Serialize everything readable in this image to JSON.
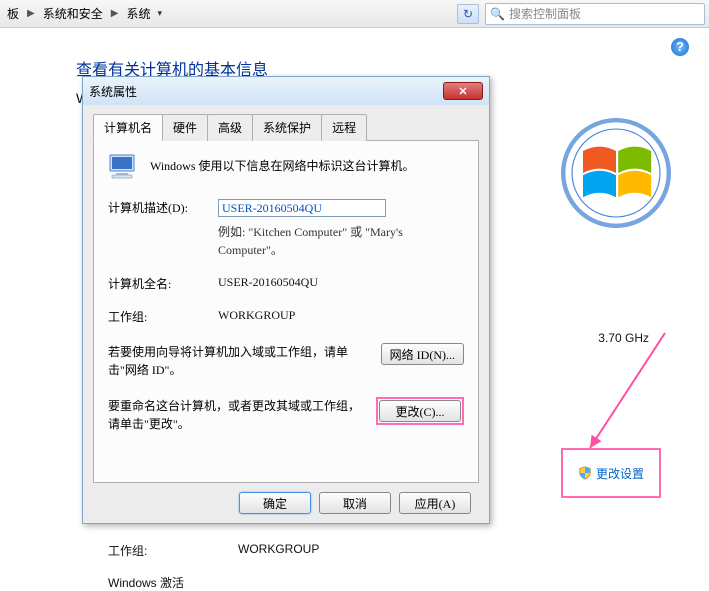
{
  "nav": {
    "crumb0": "板",
    "crumb1": "系统和安全",
    "crumb2": "系统",
    "search_placeholder": "搜索控制面板"
  },
  "page": {
    "title": "查看有关计算机的基本信息",
    "letter": "W",
    "ghz": "3.70 GHz",
    "change_settings": "更改设置",
    "wg_label": "工作组:",
    "wg_value": "WORKGROUP",
    "activation": "Windows 激活"
  },
  "dialog": {
    "title": "系统属性",
    "tabs": [
      "计算机名",
      "硬件",
      "高级",
      "系统保护",
      "远程"
    ],
    "intro": "Windows 使用以下信息在网络中标识这台计算机。",
    "desc_label": "计算机描述(D):",
    "desc_value": "USER-20160504QU",
    "example": "例如: \"Kitchen Computer\" 或 \"Mary's Computer\"。",
    "fullname_label": "计算机全名:",
    "fullname_value": "USER-20160504QU",
    "workgroup_label": "工作组:",
    "workgroup_value": "WORKGROUP",
    "wizard_text": "若要使用向导将计算机加入域或工作组，请单击\"网络 ID\"。",
    "network_id_btn": "网络 ID(N)...",
    "rename_text": "要重命名这台计算机，或者更改其域或工作组，请单击\"更改\"。",
    "change_btn": "更改(C)...",
    "ok": "确定",
    "cancel": "取消",
    "apply": "应用(A)"
  }
}
